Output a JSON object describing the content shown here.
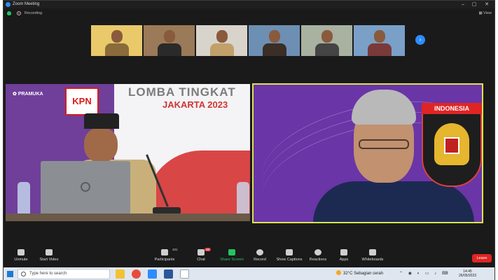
{
  "window": {
    "title": "Zoom Meeting"
  },
  "topbar": {
    "recording_label": "Recording",
    "view_label": "View"
  },
  "gallery": {
    "thumbnails": [
      {
        "name": "participant-1",
        "bg": "#e9c96a",
        "shirt": "#8a6b3a"
      },
      {
        "name": "participant-2",
        "bg": "#9a7a58",
        "shirt": "#2a2a2a"
      },
      {
        "name": "participant-3",
        "bg": "#d8d4cc",
        "shirt": "#c2a06a"
      },
      {
        "name": "participant-4",
        "bg": "#6d8fb3",
        "shirt": "#3a2e26"
      },
      {
        "name": "participant-5",
        "bg": "#a9b1a0",
        "shirt": "#444444"
      },
      {
        "name": "participant-6",
        "bg": "#7aa0c8",
        "shirt": "#7a3a3a"
      }
    ],
    "next_icon": "›"
  },
  "left_tile": {
    "event_title": "LOMBA TINGKAT",
    "event_city": "JAKARTA 2023",
    "logo_text": "PRAMUKA",
    "kpn_text": "KPN"
  },
  "right_tile": {
    "emblem_label": "INDONESIA"
  },
  "toolbar": {
    "unmute": "Unmute",
    "start_video": "Start Video",
    "participants": "Participants",
    "participants_count": "101",
    "chat": "Chat",
    "chat_badge": "46",
    "share_screen": "Share Screen",
    "record": "Record",
    "show_captions": "Show Captions",
    "reactions": "Reactions",
    "apps": "Apps",
    "whiteboards": "Whiteboards",
    "leave": "Leave"
  },
  "taskbar": {
    "search_placeholder": "Type here to search",
    "weather": "32°C  Sebagian cerah",
    "time": "14:45",
    "date": "26/05/2023"
  },
  "colors": {
    "accent": "#2d8cff",
    "leave_red": "#e02424",
    "share_green": "#23c55e",
    "speaker_bg": "#6a35a7",
    "active_border": "#d9e64a"
  }
}
